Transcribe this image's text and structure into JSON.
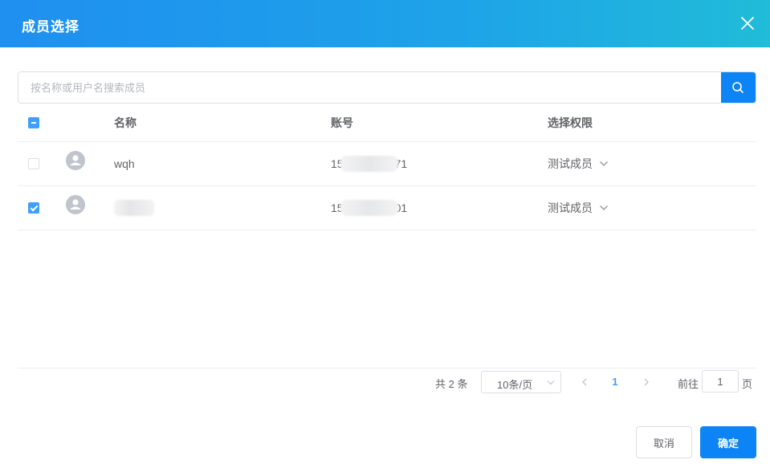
{
  "dialog": {
    "title": "成员选择",
    "close_icon": "close-icon"
  },
  "search": {
    "placeholder": "按名称或用户名搜索成员",
    "value": "",
    "icon": "search-icon"
  },
  "table": {
    "headers": {
      "name": "名称",
      "account": "账号",
      "permission": "选择权限"
    },
    "select_all_state": "indeterminate",
    "rows": [
      {
        "checked": false,
        "name": "wqh",
        "account_prefix": "15",
        "account_suffix": "71",
        "permission": "测试成员"
      },
      {
        "checked": true,
        "name": "",
        "account_prefix": "15",
        "account_suffix": "01",
        "permission": "测试成员"
      }
    ]
  },
  "pagination": {
    "total_text": "共 2 条",
    "page_size": "10条/页",
    "current_page": "1",
    "goto_label": "前往",
    "goto_value": "1",
    "goto_suffix": "页"
  },
  "footer": {
    "cancel_label": "取消",
    "confirm_label": "确定"
  },
  "colors": {
    "primary": "#409eff",
    "button_blue": "#0d84f5",
    "header_gradient_start": "#1f8ff0",
    "header_gradient_end": "#20bcd8"
  }
}
